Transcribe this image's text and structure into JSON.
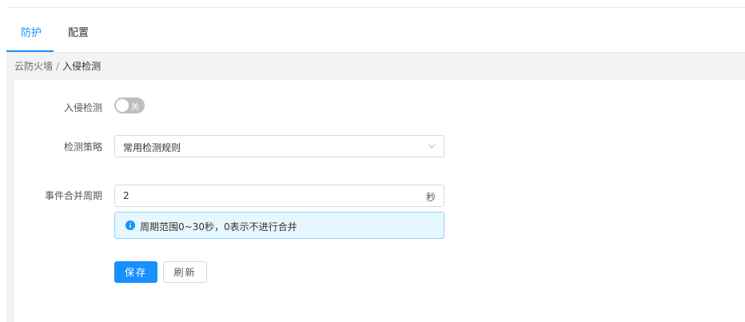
{
  "tabs": [
    {
      "label": "防护",
      "active": true
    },
    {
      "label": "配置",
      "active": false
    }
  ],
  "breadcrumb": {
    "root": "云防火墙",
    "separator": "/",
    "current": "入侵检测"
  },
  "form": {
    "intrusion_detection": {
      "label": "入侵检测",
      "switch_text": "关",
      "enabled": false
    },
    "policy": {
      "label": "检测策略",
      "selected": "常用检测规则"
    },
    "merge_period": {
      "label": "事件合并周期",
      "value": "2",
      "unit": "秒",
      "hint": "周期范围0~30秒，0表示不进行合并"
    }
  },
  "buttons": {
    "save": "保存",
    "refresh": "刷新"
  },
  "colors": {
    "primary": "#1890ff",
    "alert_bg": "#e6f7ff",
    "alert_border": "#91d5ff",
    "switch_off": "#bfbfbf"
  }
}
